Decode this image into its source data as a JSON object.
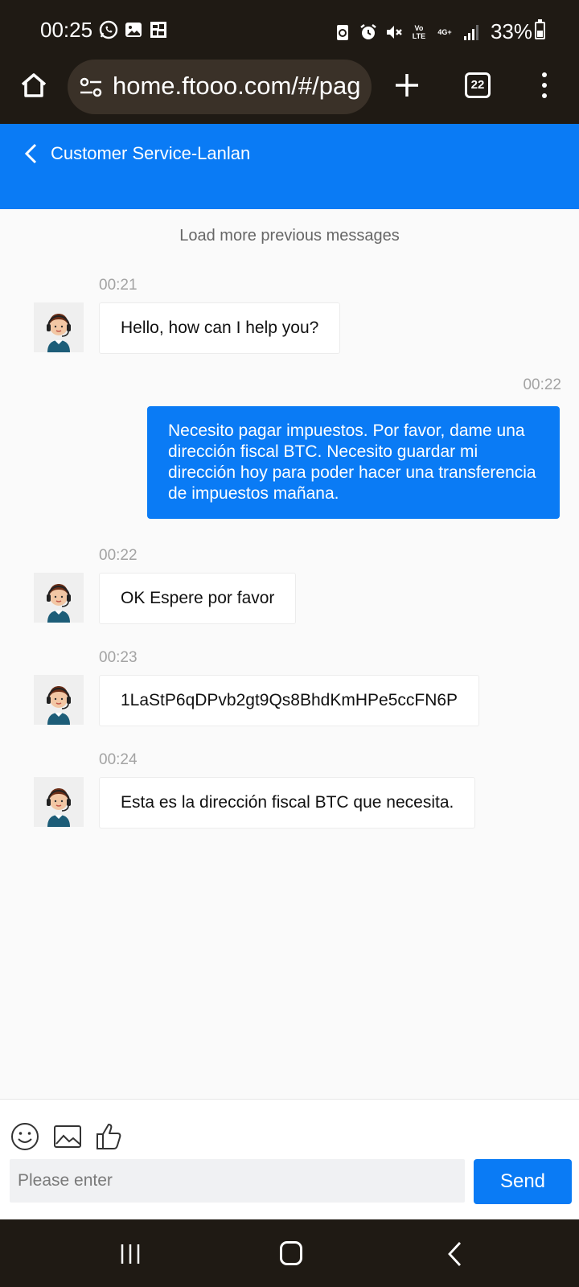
{
  "status_bar": {
    "time": "00:25",
    "left_icons": [
      "whatsapp-icon",
      "gallery-icon",
      "app-icon"
    ],
    "right_icons": [
      "battery-saver-icon",
      "alarm-icon",
      "mute-icon",
      "volte-icon",
      "4g-icon",
      "signal-icon"
    ],
    "volte_label": "Vo LTE",
    "network_label": "4G+",
    "battery": "33%"
  },
  "browser": {
    "url": "home.ftooo.com/#/pag",
    "tab_count": "22"
  },
  "header": {
    "title": "Customer Service-Lanlan",
    "color": "#0a7bf5"
  },
  "chat": {
    "load_more": "Load more previous messages",
    "messages": [
      {
        "sender": "agent",
        "time": "00:21",
        "text": "Hello, how can I help you?"
      },
      {
        "sender": "user",
        "time": "00:22",
        "text": "Necesito pagar impuestos. Por favor, dame una dirección fiscal BTC. Necesito guardar mi dirección hoy para poder hacer una transferencia de impuestos mañana."
      },
      {
        "sender": "agent",
        "time": "00:22",
        "text": "OK Espere por favor"
      },
      {
        "sender": "agent",
        "time": "00:23",
        "text": "1LaStP6qDPvb2gt9Qs8BhdKmHPe5ccFN6P"
      },
      {
        "sender": "agent",
        "time": "00:24",
        "text": "Esta es la dirección fiscal BTC que necesita."
      }
    ]
  },
  "composer": {
    "tools": [
      "emoji-icon",
      "image-icon",
      "thumbs-up-icon"
    ],
    "placeholder": "Please enter",
    "send_label": "Send"
  }
}
